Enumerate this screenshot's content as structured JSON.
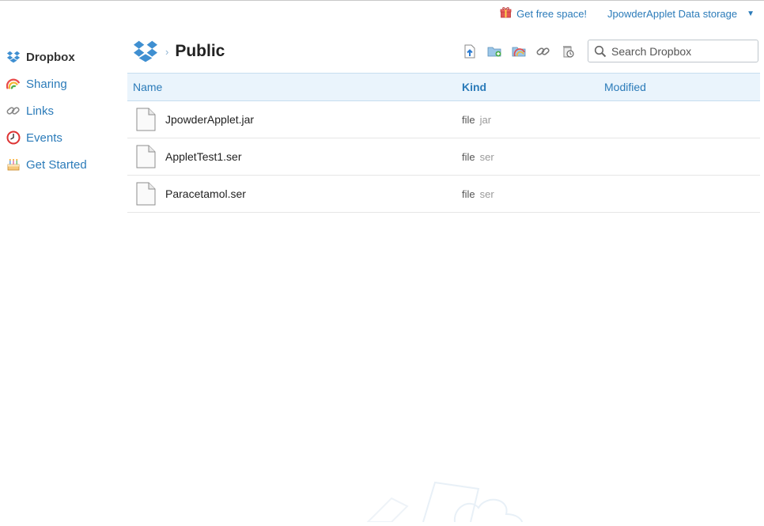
{
  "header": {
    "free_space_label": "Get free space!",
    "account_label": "JpowderApplet Data storage"
  },
  "sidebar": {
    "items": [
      {
        "label": "Dropbox",
        "icon": "dropbox-icon",
        "active": true
      },
      {
        "label": "Sharing",
        "icon": "rainbow-icon"
      },
      {
        "label": "Links",
        "icon": "link-icon"
      },
      {
        "label": "Events",
        "icon": "clock-icon"
      },
      {
        "label": "Get Started",
        "icon": "cake-icon"
      }
    ]
  },
  "breadcrumb": {
    "current": "Public"
  },
  "toolbar": {
    "buttons": [
      "upload-icon",
      "new-folder-icon",
      "share-folder-icon",
      "get-link-icon",
      "deleted-files-icon"
    ]
  },
  "search": {
    "placeholder": "Search Dropbox"
  },
  "table": {
    "columns": {
      "name": "Name",
      "kind": "Kind",
      "modified": "Modified"
    },
    "sorted_by": "Kind",
    "rows": [
      {
        "name": "JpowderApplet.jar",
        "kind": "file",
        "ext": "jar",
        "modified": ""
      },
      {
        "name": "AppletTest1.ser",
        "kind": "file",
        "ext": "ser",
        "modified": ""
      },
      {
        "name": "Paracetamol.ser",
        "kind": "file",
        "ext": "ser",
        "modified": ""
      }
    ]
  },
  "colors": {
    "link": "#2b7bb9",
    "header_bg": "#eaf4fc"
  }
}
